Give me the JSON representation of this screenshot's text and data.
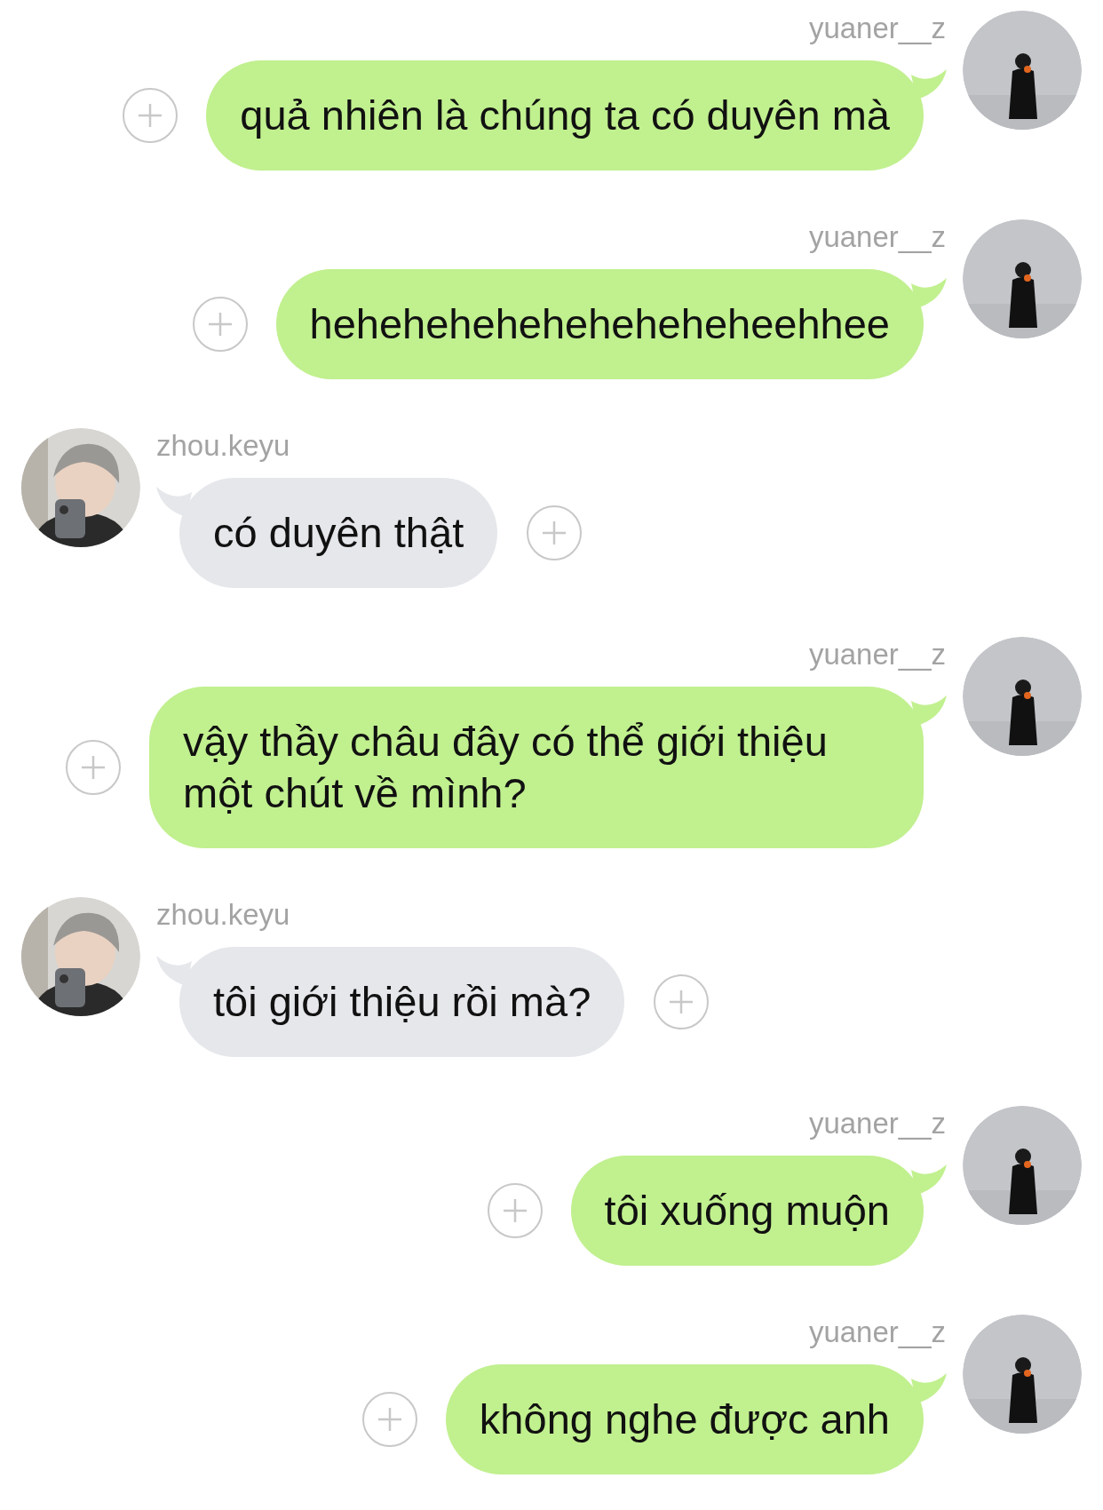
{
  "messages": [
    {
      "kind": "outgoing",
      "sender": "yuaner__z",
      "text": "quả nhiên là chúng ta có duyên mà"
    },
    {
      "kind": "outgoing",
      "sender": "yuaner__z",
      "text": "heheheheheheheheheheehhee"
    },
    {
      "kind": "incoming",
      "sender": "zhou.keyu",
      "text": "có duyên thật"
    },
    {
      "kind": "outgoing",
      "sender": "yuaner__z",
      "text": "vậy thầy châu đây có thể giới thiệu một chút về mình?"
    },
    {
      "kind": "incoming",
      "sender": "zhou.keyu",
      "text": "tôi giới thiệu rồi mà?"
    },
    {
      "kind": "outgoing",
      "sender": "yuaner__z",
      "text": "tôi xuống muộn"
    },
    {
      "kind": "outgoing",
      "sender": "yuaner__z",
      "text": "không nghe được anh"
    }
  ]
}
